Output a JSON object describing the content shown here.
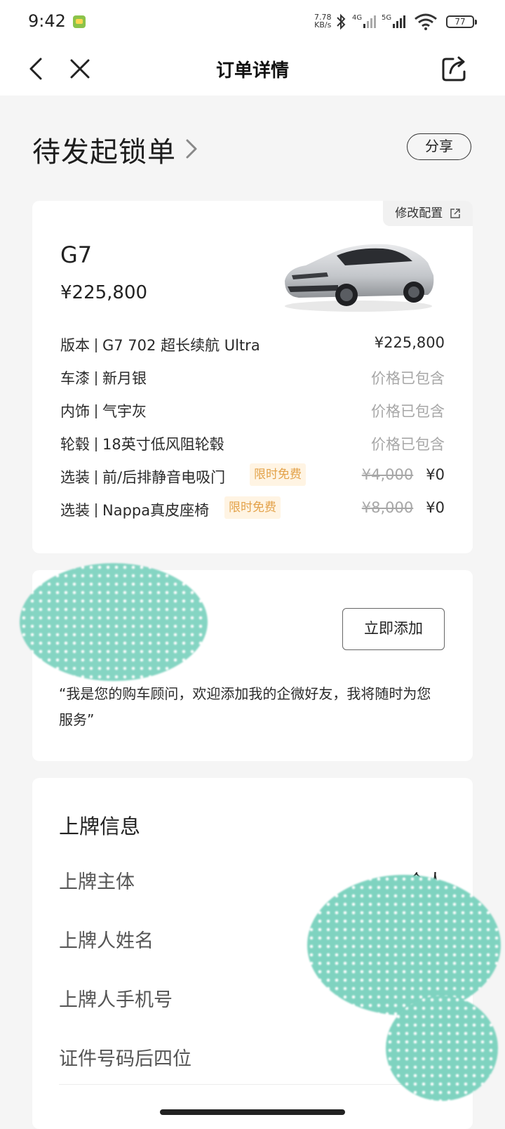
{
  "status_bar": {
    "time": "9:42",
    "net_speed_value": "7.78",
    "net_speed_unit": "KB/s",
    "net_4g": "4G",
    "net_5g": "5G",
    "battery": "77"
  },
  "nav": {
    "title": "订单详情",
    "back_icon": "chevron-left-icon",
    "close_icon": "close-icon",
    "share_icon": "share-external-icon"
  },
  "header": {
    "status": "待发起锁单",
    "share_label": "分享"
  },
  "config": {
    "modify_label": "修改配置",
    "model": "G7",
    "price": "¥225,800",
    "rows": [
      {
        "type": "版本",
        "name": "G7 702 超长续航 Ultra",
        "value": "¥225,800"
      },
      {
        "type": "车漆",
        "name": "新月银",
        "value": "价格已包含"
      },
      {
        "type": "内饰",
        "name": "气宇灰",
        "value": "价格已包含"
      },
      {
        "type": "轮毂",
        "name": "18英寸低风阻轮毂",
        "value": "价格已包含"
      },
      {
        "type": "选装",
        "name": "前/后排静音电吸门",
        "badge": "限时免费",
        "original": "¥4,000",
        "value": "¥0"
      },
      {
        "type": "选装",
        "name": "Nappa真皮座椅",
        "badge": "限时免费",
        "original": "¥8,000",
        "value": "¥0"
      }
    ]
  },
  "advisor": {
    "add_label": "立即添加",
    "message": "“我是您的购车顾问，欢迎添加我的企微好友，我将随时为您服务”"
  },
  "registration": {
    "title": "上牌信息",
    "rows": [
      {
        "label": "上牌主体",
        "value": "个人"
      },
      {
        "label": "上牌人姓名",
        "value": ""
      },
      {
        "label": "上牌人手机号",
        "value": ""
      },
      {
        "label": "证件号码后四位",
        "value": ""
      }
    ]
  },
  "colors": {
    "accent_badge_bg": "#fff4e3",
    "accent_badge_text": "#e3a24a",
    "redaction": "#7fd3c0"
  }
}
